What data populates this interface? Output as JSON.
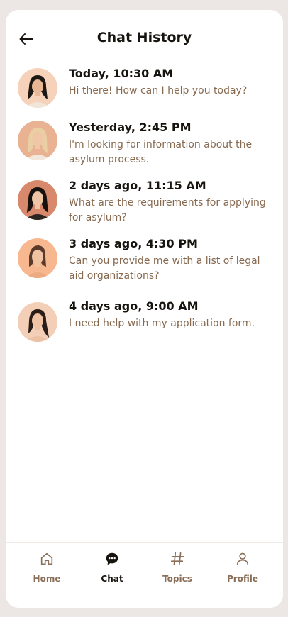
{
  "header": {
    "title": "Chat History",
    "back_icon": "arrow-left-icon"
  },
  "conversations": [
    {
      "date": "Today, 10:30 AM",
      "message": "Hi there! How can I help you today?",
      "avatar": "avatar-woman-dark-hair"
    },
    {
      "date": "Yesterday, 2:45 PM",
      "message": "I'm looking for information about the asylum process.",
      "avatar": "avatar-woman-blonde-hair"
    },
    {
      "date": "2 days ago, 11:15 AM",
      "message": "What are the requirements for applying for asylum?",
      "avatar": "avatar-woman-dark-hair"
    },
    {
      "date": "3 days ago, 4:30 PM",
      "message": "Can you provide me with a list of legal aid organizations?",
      "avatar": "avatar-woman-brown-hair"
    },
    {
      "date": "4 days ago, 9:00 AM",
      "message": "I need help with my application form.",
      "avatar": "avatar-woman-dark-hair"
    }
  ],
  "nav": {
    "items": [
      {
        "label": "Home",
        "icon": "home-icon"
      },
      {
        "label": "Chat",
        "icon": "chat-bubble-icon",
        "active": true
      },
      {
        "label": "Topics",
        "icon": "hashtag-icon"
      },
      {
        "label": "Profile",
        "icon": "user-icon"
      }
    ]
  },
  "colors": {
    "background": "#ECE7E4",
    "card": "#FFFFFF",
    "text_primary": "#17140F",
    "text_secondary": "#86694F",
    "avatar_bg": "#F6D2BB"
  }
}
